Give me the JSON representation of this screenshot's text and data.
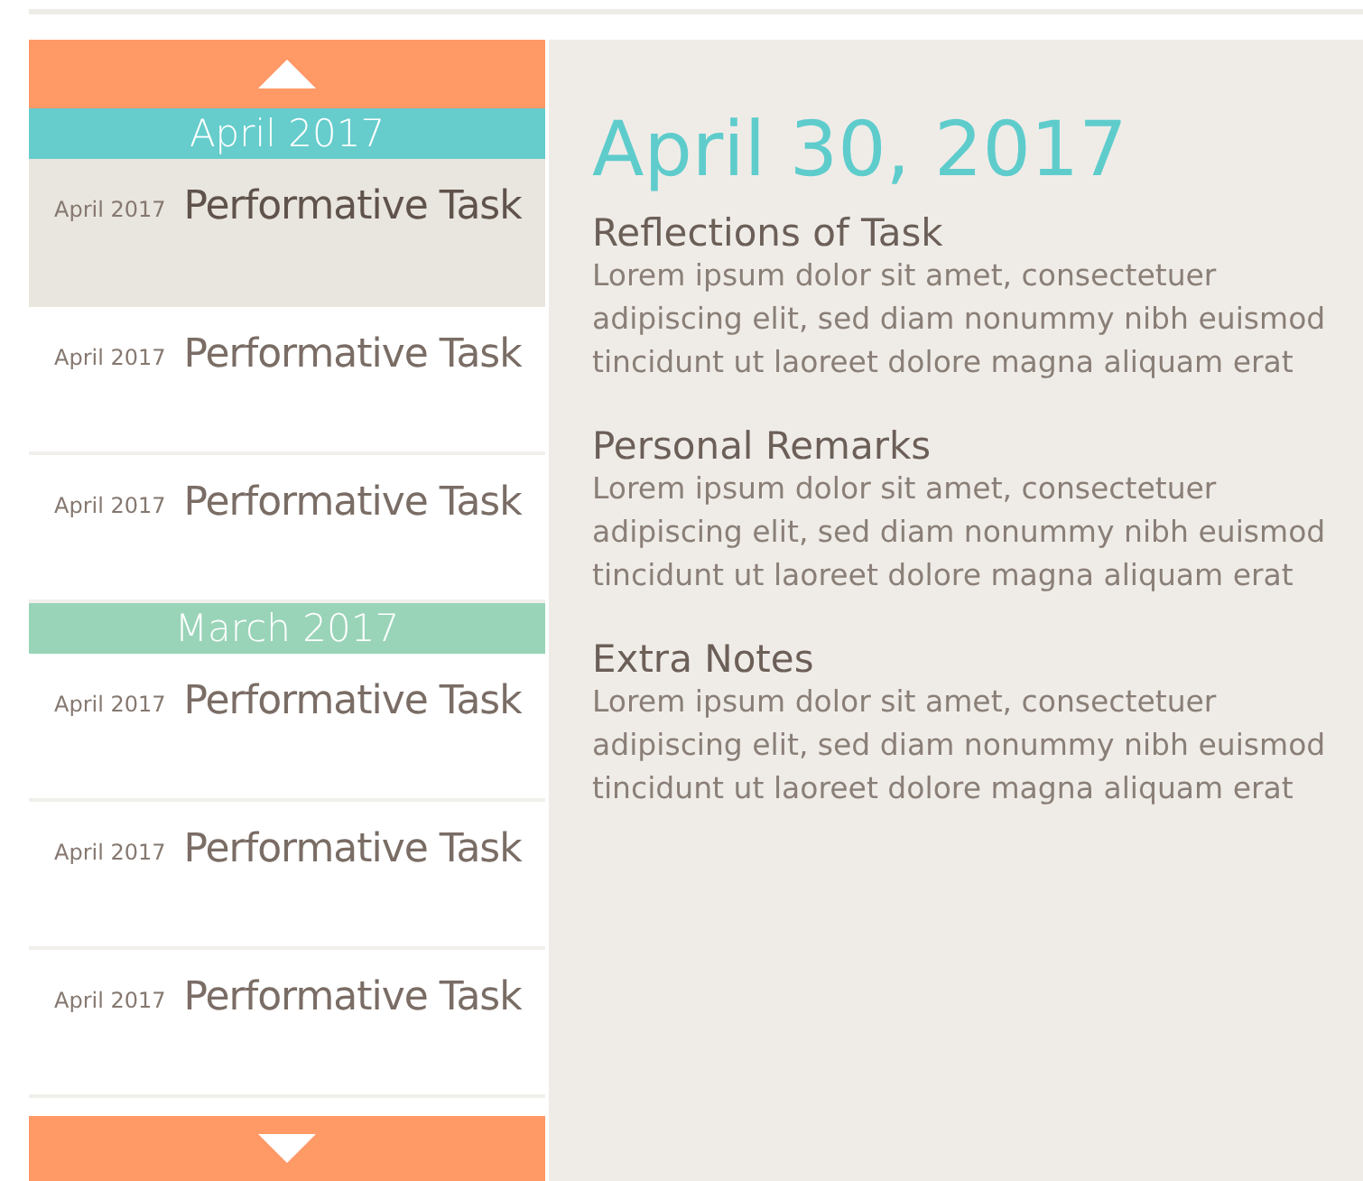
{
  "sidebar": {
    "groups": [
      {
        "header": "April 2017",
        "color": "#66cccc",
        "items": [
          {
            "date": "April 2017",
            "title": "Performative Task",
            "selected": true
          },
          {
            "date": "April 2017",
            "title": "Performative Task",
            "selected": false
          },
          {
            "date": "April 2017",
            "title": "Performative Task",
            "selected": false
          }
        ]
      },
      {
        "header": "March 2017",
        "color": "#99d4b8",
        "items": [
          {
            "date": "April 2017",
            "title": "Performative Task",
            "selected": false
          },
          {
            "date": "April 2017",
            "title": "Performative Task",
            "selected": false
          },
          {
            "date": "April 2017",
            "title": "Performative Task",
            "selected": false
          }
        ]
      }
    ]
  },
  "detail": {
    "date": "April 30, 2017",
    "sections": [
      {
        "heading": "Reflections of Task",
        "body": "Lorem ipsum dolor sit amet, consectetuer adipiscing elit, sed diam nonummy nibh euismod tincidunt ut laoreet dolore magna aliquam erat"
      },
      {
        "heading": "Personal Remarks",
        "body": "Lorem ipsum dolor sit amet, consectetuer adipiscing elit, sed diam nonummy nibh euismod tincidunt ut laoreet dolore magna aliquam erat"
      },
      {
        "heading": "Extra Notes",
        "body": "Lorem ipsum dolor sit amet, consectetuer adipiscing elit, sed diam nonummy nibh euismod tincidunt ut laoreet dolore magna aliquam erat"
      }
    ]
  }
}
